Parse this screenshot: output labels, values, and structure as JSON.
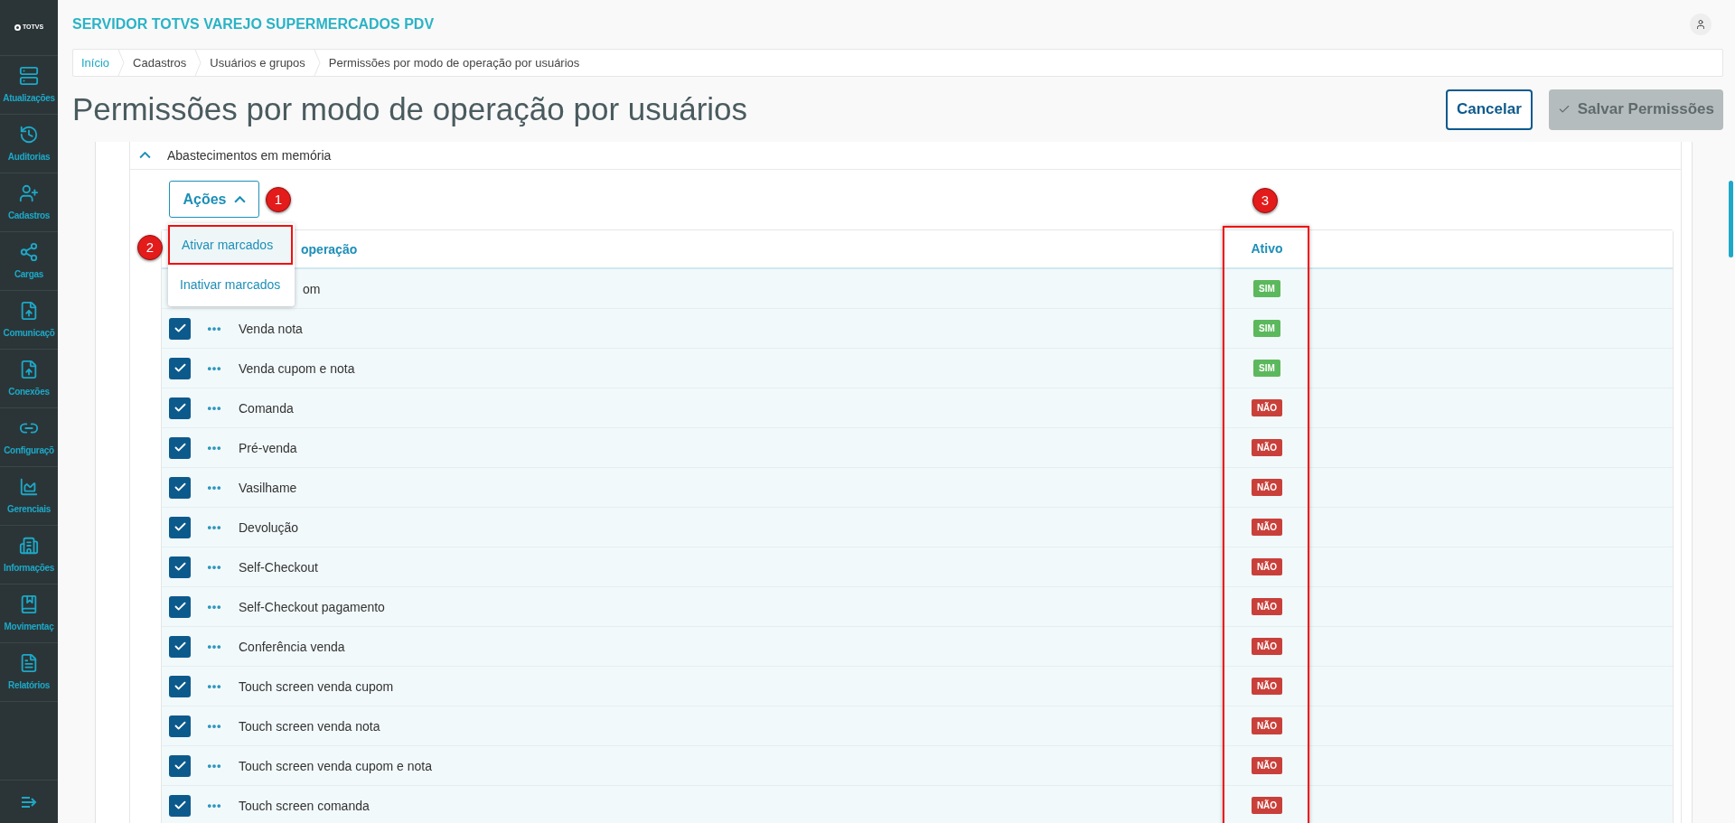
{
  "sidebar": {
    "logo": "TOTVS",
    "items": [
      {
        "label": "Atualizações"
      },
      {
        "label": "Auditorias"
      },
      {
        "label": "Cadastros"
      },
      {
        "label": "Cargas"
      },
      {
        "label": "Comunicaçõ"
      },
      {
        "label": "Conexões"
      },
      {
        "label": "Configuraçõ"
      },
      {
        "label": "Gerenciais"
      },
      {
        "label": "Informações"
      },
      {
        "label": "Movimentaç"
      },
      {
        "label": "Relatórios"
      }
    ]
  },
  "header": {
    "title": "SERVIDOR TOTVS VAREJO SUPERMERCADOS PDV"
  },
  "breadcrumb": [
    "Início",
    "Cadastros",
    "Usuários e grupos",
    "Permissões por modo de operação por usuários"
  ],
  "page": {
    "title": "Permissões por modo de operação por usuários",
    "buttons": [
      {
        "label": "Cancelar",
        "kind": "outline",
        "disabled": false
      },
      {
        "label": "Salvar Permissões",
        "kind": "primary",
        "disabled": true
      }
    ]
  },
  "section": {
    "title": "Abastecimentos em memória",
    "expanded": true
  },
  "actions": {
    "label": "Ações",
    "expanded": true,
    "menu": [
      {
        "label": "Ativar marcados",
        "selected": true
      },
      {
        "label": "Inativar marcados",
        "selected": false
      }
    ]
  },
  "annotations": [
    "1",
    "2",
    "3"
  ],
  "table": {
    "columns": [
      "operação",
      "Ativo"
    ],
    "rows": [
      {
        "name": "om",
        "active": true,
        "status": "SIM"
      },
      {
        "name": "Venda nota",
        "checked": true,
        "active": true,
        "status": "SIM"
      },
      {
        "name": "Venda cupom e nota",
        "checked": true,
        "active": true,
        "status": "SIM"
      },
      {
        "name": "Comanda",
        "checked": true,
        "active": false,
        "status": "NÃO"
      },
      {
        "name": "Pré-venda",
        "checked": true,
        "active": false,
        "status": "NÃO"
      },
      {
        "name": "Vasilhame",
        "checked": true,
        "active": false,
        "status": "NÃO"
      },
      {
        "name": "Devolução",
        "checked": true,
        "active": false,
        "status": "NÃO"
      },
      {
        "name": "Self-Checkout",
        "checked": true,
        "active": false,
        "status": "NÃO"
      },
      {
        "name": "Self-Checkout pagamento",
        "checked": true,
        "active": false,
        "status": "NÃO"
      },
      {
        "name": "Conferência venda",
        "checked": true,
        "active": false,
        "status": "NÃO"
      },
      {
        "name": "Touch screen venda cupom",
        "checked": true,
        "active": false,
        "status": "NÃO"
      },
      {
        "name": "Touch screen venda nota",
        "checked": true,
        "active": false,
        "status": "NÃO"
      },
      {
        "name": "Touch screen venda cupom e nota",
        "checked": true,
        "active": false,
        "status": "NÃO"
      },
      {
        "name": "Touch screen comanda",
        "checked": true,
        "active": false,
        "status": "NÃO"
      }
    ]
  }
}
